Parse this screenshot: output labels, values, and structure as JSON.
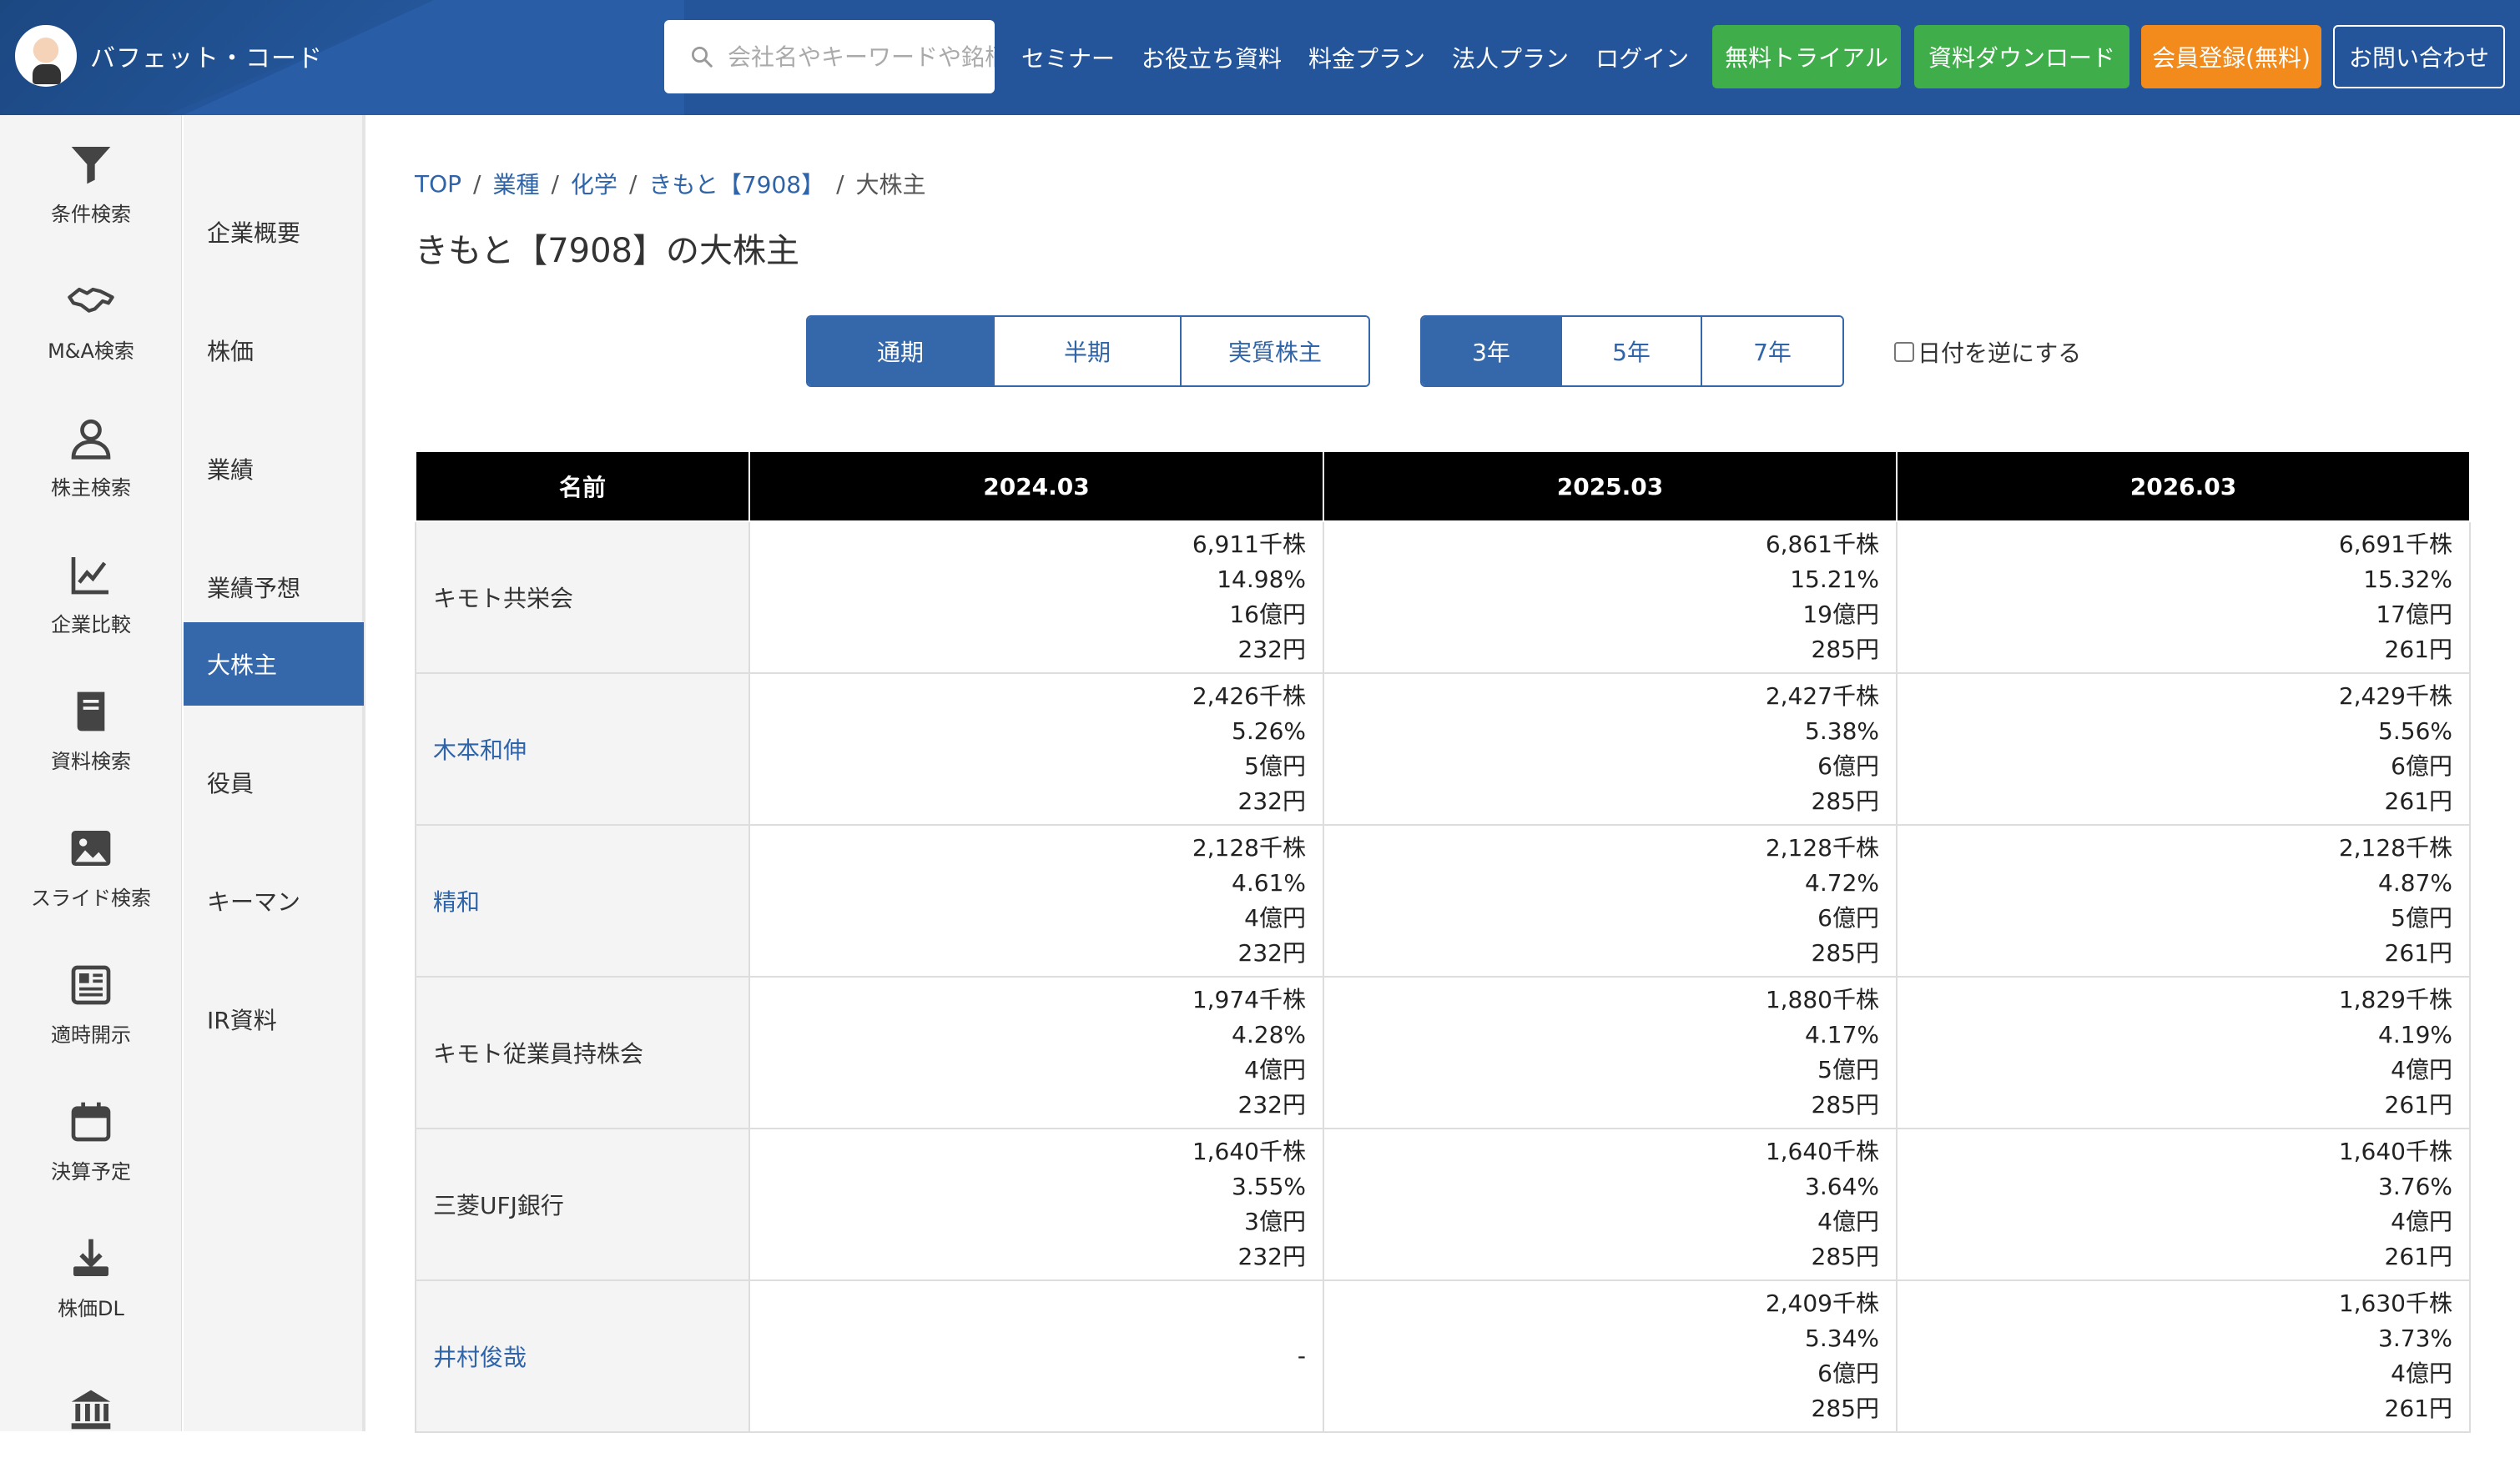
{
  "header": {
    "logo_text": "バフェット・コード",
    "search_placeholder": "会社名やキーワードや銘柄",
    "nav": [
      "セミナー",
      "お役立ち資料",
      "料金プラン",
      "法人プラン",
      "ログイン"
    ],
    "buttons": {
      "trial": "無料トライアル",
      "download": "資料ダウンロード",
      "register": "会員登録(無料)",
      "contact": "お問い合わせ"
    },
    "colors": {
      "header_bg": "#24559b",
      "green": "#3fae4a",
      "orange": "#f28a1c"
    }
  },
  "iconbar": [
    {
      "label": "条件検索",
      "icon": "filter-icon"
    },
    {
      "label": "M&A検索",
      "icon": "handshake-icon"
    },
    {
      "label": "株主検索",
      "icon": "person-icon"
    },
    {
      "label": "企業比較",
      "icon": "chart-line-icon"
    },
    {
      "label": "資料検索",
      "icon": "book-icon"
    },
    {
      "label": "スライド検索",
      "icon": "image-icon"
    },
    {
      "label": "適時開示",
      "icon": "newspaper-icon"
    },
    {
      "label": "決算予定",
      "icon": "calendar-icon"
    },
    {
      "label": "株価DL",
      "icon": "download-icon"
    },
    {
      "label": "",
      "icon": "bank-icon"
    }
  ],
  "subnav": [
    {
      "label": "企業概要",
      "active": false
    },
    {
      "label": "株価",
      "active": false
    },
    {
      "label": "業績",
      "active": false
    },
    {
      "label": "業績予想",
      "active": false
    },
    {
      "label": "大株主",
      "active": true
    },
    {
      "label": "役員",
      "active": false
    },
    {
      "label": "キーマン",
      "active": false
    },
    {
      "label": "IR資料",
      "active": false
    }
  ],
  "breadcrumb": [
    "TOP",
    "業種",
    "化学",
    "きもと【7908】",
    "大株主"
  ],
  "page_title": "きもと【7908】の大株主",
  "type_tabs": [
    {
      "label": "通期",
      "active": true
    },
    {
      "label": "半期",
      "active": false
    },
    {
      "label": "実質株主",
      "active": false
    }
  ],
  "year_tabs": [
    {
      "label": "3年",
      "active": true
    },
    {
      "label": "5年",
      "active": false
    },
    {
      "label": "7年",
      "active": false
    }
  ],
  "reverse_label": "日付を逆にする",
  "table": {
    "headers": [
      "名前",
      "2024.03",
      "2025.03",
      "2026.03"
    ],
    "rows": [
      {
        "name": "キモト共栄会",
        "link": false,
        "cells": [
          [
            "6,911千株",
            "14.98%",
            "16億円",
            "232円"
          ],
          [
            "6,861千株",
            "15.21%",
            "19億円",
            "285円"
          ],
          [
            "6,691千株",
            "15.32%",
            "17億円",
            "261円"
          ]
        ]
      },
      {
        "name": "木本和伸",
        "link": true,
        "cells": [
          [
            "2,426千株",
            "5.26%",
            "5億円",
            "232円"
          ],
          [
            "2,427千株",
            "5.38%",
            "6億円",
            "285円"
          ],
          [
            "2,429千株",
            "5.56%",
            "6億円",
            "261円"
          ]
        ]
      },
      {
        "name": "精和",
        "link": true,
        "cells": [
          [
            "2,128千株",
            "4.61%",
            "4億円",
            "232円"
          ],
          [
            "2,128千株",
            "4.72%",
            "6億円",
            "285円"
          ],
          [
            "2,128千株",
            "4.87%",
            "5億円",
            "261円"
          ]
        ]
      },
      {
        "name": "キモト従業員持株会",
        "link": false,
        "cells": [
          [
            "1,974千株",
            "4.28%",
            "4億円",
            "232円"
          ],
          [
            "1,880千株",
            "4.17%",
            "5億円",
            "285円"
          ],
          [
            "1,829千株",
            "4.19%",
            "4億円",
            "261円"
          ]
        ]
      },
      {
        "name": "三菱UFJ銀行",
        "link": false,
        "cells": [
          [
            "1,640千株",
            "3.55%",
            "3億円",
            "232円"
          ],
          [
            "1,640千株",
            "3.64%",
            "4億円",
            "285円"
          ],
          [
            "1,640千株",
            "3.76%",
            "4億円",
            "261円"
          ]
        ]
      },
      {
        "name": "井村俊哉",
        "link": true,
        "cells": [
          [
            "-"
          ],
          [
            "2,409千株",
            "5.34%",
            "6億円",
            "285円"
          ],
          [
            "1,630千株",
            "3.73%",
            "4億円",
            "261円"
          ]
        ]
      }
    ]
  }
}
